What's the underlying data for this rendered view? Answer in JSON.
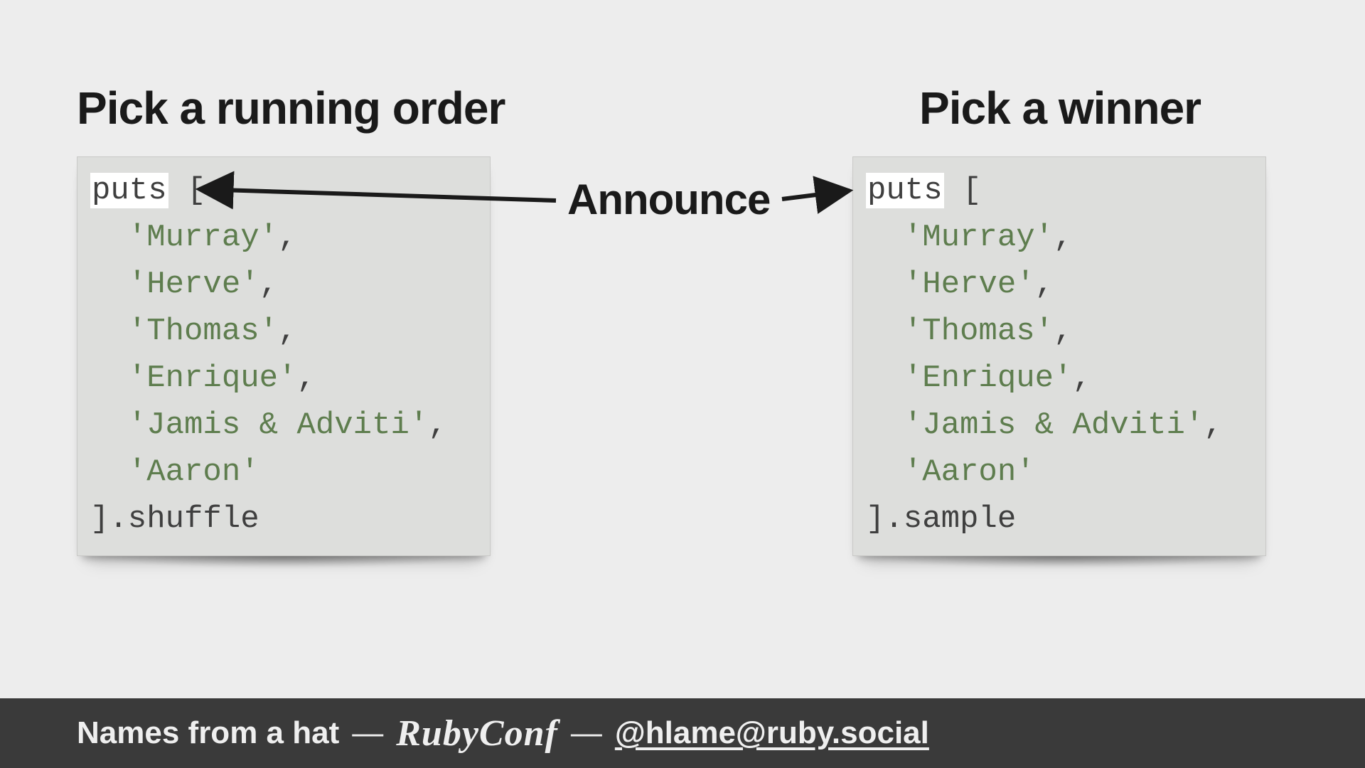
{
  "left": {
    "title": "Pick a running order",
    "keyword": "puts",
    "open": "[",
    "names": [
      "Murray",
      "Herve",
      "Thomas",
      "Enrique",
      "Jamis & Adviti",
      "Aaron"
    ],
    "close_method": "].shuffle"
  },
  "right": {
    "title": "Pick a winner",
    "keyword": "puts",
    "open": "[",
    "names": [
      "Murray",
      "Herve",
      "Thomas",
      "Enrique",
      "Jamis & Adviti",
      "Aaron"
    ],
    "close_method": "].sample"
  },
  "center_label": "Announce",
  "footer": {
    "talk_title": "Names from a hat",
    "sep": "—",
    "event": "RubyConf",
    "handle": "@hlame@ruby.social"
  }
}
